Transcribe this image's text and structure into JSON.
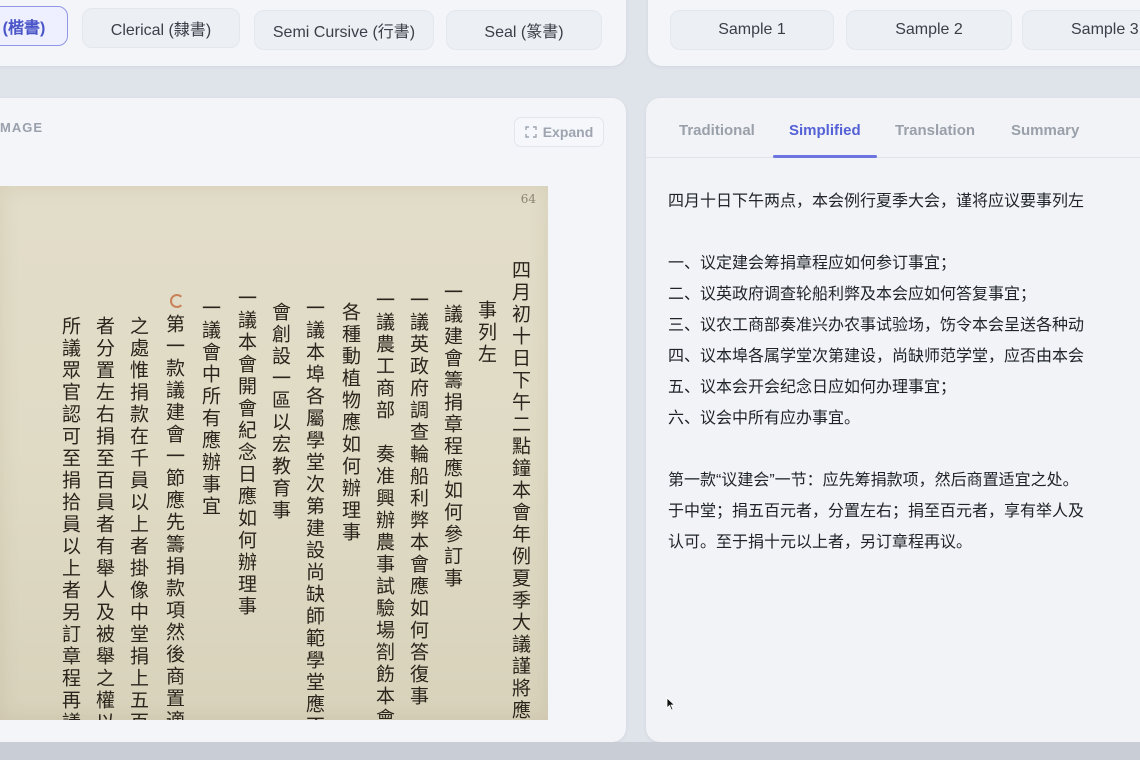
{
  "style_tabs": [
    {
      "label": "(楷書)",
      "active": true
    },
    {
      "label": "Clerical (隸書)",
      "active": false
    },
    {
      "label": "Semi Cursive (行書)",
      "active": false
    },
    {
      "label": "Seal (篆書)",
      "active": false
    }
  ],
  "sample_tabs": [
    {
      "label": "Sample 1"
    },
    {
      "label": "Sample 2"
    },
    {
      "label": "Sample 3"
    }
  ],
  "image_panel": {
    "section_label": "MAGE",
    "expand_label": "Expand",
    "expand_icon": "expand-icon",
    "page_number": "64",
    "manuscript_columns": [
      "四月初十日下午二點鐘本會年例夏季大議謹將應議要",
      "事列左",
      "一議建會籌捐章程應如何參訂事",
      "一議英政府調查輪船利弊本會應如何答復事",
      "一議農工商部　奏准興辦農事試驗場劄飭本會呈送",
      "各種動植物應如何辦理事",
      "一議本埠各屬學堂次第建設尚缺師範學堂應否由本",
      "會創設一區以宏教育事",
      "一議本會開會紀念日應如何辦理事",
      "一議會中所有應辦事宜",
      "第一款議建會一節應先籌捐款項然後商置適宜",
      "之處惟捐款在千員以上者掛像中堂捐上五百員",
      "者分置左右捐至百員者有舉人及被舉之權以上",
      "所議眾官認可至捐拾員以上者另訂章程再議"
    ]
  },
  "text_panel": {
    "tabs": [
      {
        "label": "Traditional",
        "active": false
      },
      {
        "label": "Simplified",
        "active": true
      },
      {
        "label": "Translation",
        "active": false
      },
      {
        "label": "Summary",
        "active": false
      }
    ],
    "lines": [
      "四月十日下午两点，本会例行夏季大会，谨将应议要事列左",
      "一、议定建会筹捐章程应如何参订事宜；",
      "二、议英政府调查轮船利弊及本会应如何答复事宜；",
      "三、议农工商部奏准兴办农事试验场，饬令本会呈送各种动",
      "四、议本埠各属学堂次第建设，尚缺师范学堂，应否由本会",
      "五、议本会开会纪念日应如何办理事宜；",
      "六、议会中所有应办事宜。",
      "第一款“议建会”一节：应先筹捐款项，然后商置适宜之处。",
      "于中堂；捐五百元者，分置左右；捐至百元者，享有举人及",
      "认可。至于捐十元以上者，另订章程再议。"
    ]
  },
  "colors": {
    "accent": "#5561d6",
    "paper": "#e0dbc5",
    "ink": "#2a241c"
  }
}
